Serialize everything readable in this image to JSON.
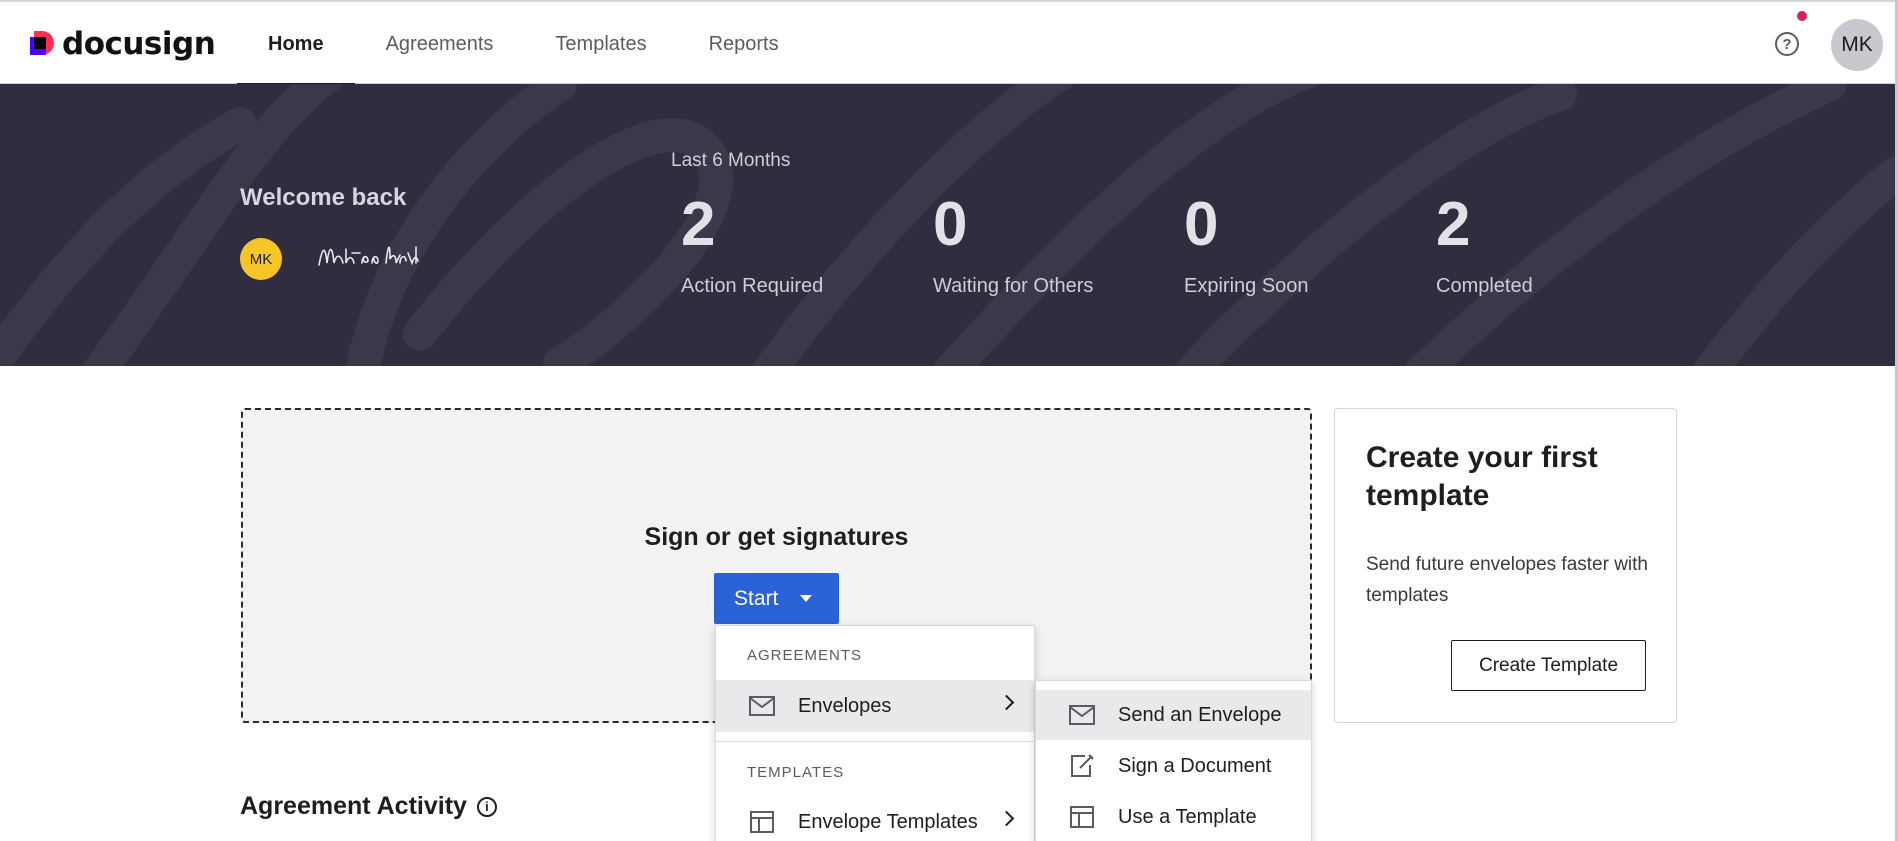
{
  "brand": {
    "name": "docusign"
  },
  "nav": {
    "items": [
      {
        "label": "Home",
        "active": true
      },
      {
        "label": "Agreements",
        "active": false
      },
      {
        "label": "Templates",
        "active": false
      },
      {
        "label": "Reports",
        "active": false
      }
    ]
  },
  "header": {
    "help_glyph": "?",
    "user_initials": "MK"
  },
  "banner": {
    "welcome": "Welcome back",
    "user_initials": "MK",
    "period": "Last 6 Months",
    "stats": [
      {
        "value": "2",
        "label": "Action Required"
      },
      {
        "value": "0",
        "label": "Waiting for Others"
      },
      {
        "value": "0",
        "label": "Expiring Soon"
      },
      {
        "value": "2",
        "label": "Completed"
      }
    ]
  },
  "sign": {
    "title": "Sign or get signatures",
    "start_label": "Start"
  },
  "template_card": {
    "title": "Create your first template",
    "description": "Send future envelopes faster with templates",
    "button": "Create Template"
  },
  "activity": {
    "title": "Agreement Activity",
    "info_glyph": "i"
  },
  "menu": {
    "agreements_heading": "AGREEMENTS",
    "envelopes": "Envelopes",
    "templates_heading": "TEMPLATES",
    "envelope_templates": "Envelope Templates"
  },
  "submenu": {
    "items": [
      "Send an Envelope",
      "Sign a Document",
      "Use a Template"
    ]
  },
  "colors": {
    "primary": "#2a62d8",
    "banner": "#302d3e",
    "avatar_yellow": "#f5c629",
    "notification": "#d6205e"
  }
}
